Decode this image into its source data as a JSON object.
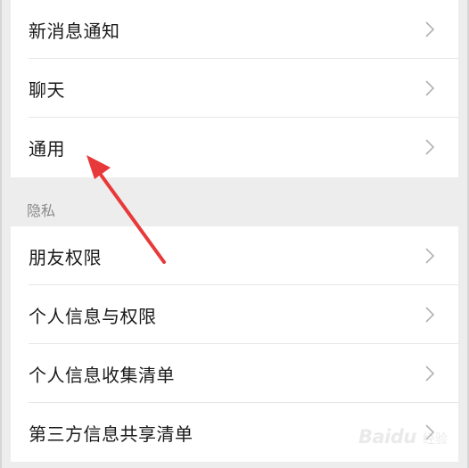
{
  "settings": {
    "group1": [
      {
        "label": "新消息通知"
      },
      {
        "label": "聊天"
      },
      {
        "label": "通用"
      }
    ],
    "privacy_header": "隐私",
    "group2": [
      {
        "label": "朋友权限"
      },
      {
        "label": "个人信息与权限"
      },
      {
        "label": "个人信息收集清单"
      },
      {
        "label": "第三方信息共享清单"
      }
    ]
  },
  "annotation": {
    "arrow_color": "#e8393a",
    "target": "通用"
  },
  "watermark": {
    "text": "Baidu",
    "sub": "经验"
  },
  "colors": {
    "background": "#ededed",
    "row_bg": "#ffffff",
    "text": "#1a1a1a",
    "section_text": "#8a8a8a",
    "chevron": "#b2b2b2"
  }
}
